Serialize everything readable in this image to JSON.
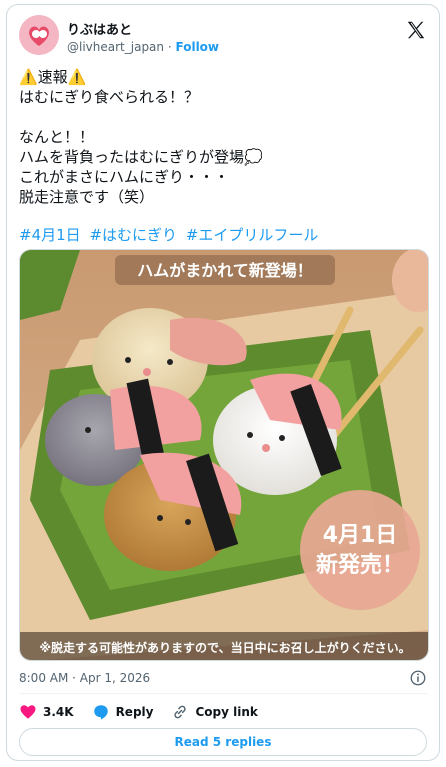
{
  "author": {
    "name": "りぶはあと",
    "handle": "@livheart_japan",
    "separator": "·",
    "follow_label": "Follow"
  },
  "post": {
    "text": "⚠️速報⚠️\nはむにぎり食べられる！？\n\nなんと！！\nハムを背負ったはむにぎりが登場💭\nこれがまさにハムにぎり・・・\n脱走注意です（笑）",
    "hashtags": [
      "#4月1日",
      "#はむにぎり",
      "#エイプリルフール"
    ]
  },
  "media": {
    "headline": "ハムがまかれて新登場！",
    "badge_line1": "4月1日",
    "badge_line2": "新発売！",
    "caption": "※脱走する可能性がありますので、当日中にお召し上がりください。"
  },
  "meta": {
    "timestamp": "8:00 AM · Apr 1, 2026"
  },
  "actions": {
    "likes": "3.4K",
    "reply_label": "Reply",
    "copy_link_label": "Copy link"
  },
  "replies_button": "Read 5 replies",
  "colors": {
    "accent": "#1d9bf0",
    "like": "#f91880"
  }
}
